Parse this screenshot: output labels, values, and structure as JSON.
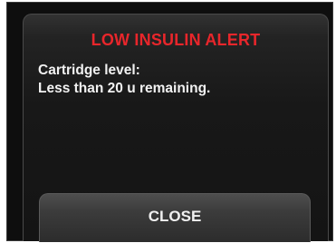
{
  "alert": {
    "title": "LOW INSULIN ALERT",
    "message_line1": "Cartridge level:",
    "message_line2": "Less than 20 u remaining.",
    "title_color": "#e8262b"
  },
  "actions": {
    "close_label": "CLOSE"
  }
}
